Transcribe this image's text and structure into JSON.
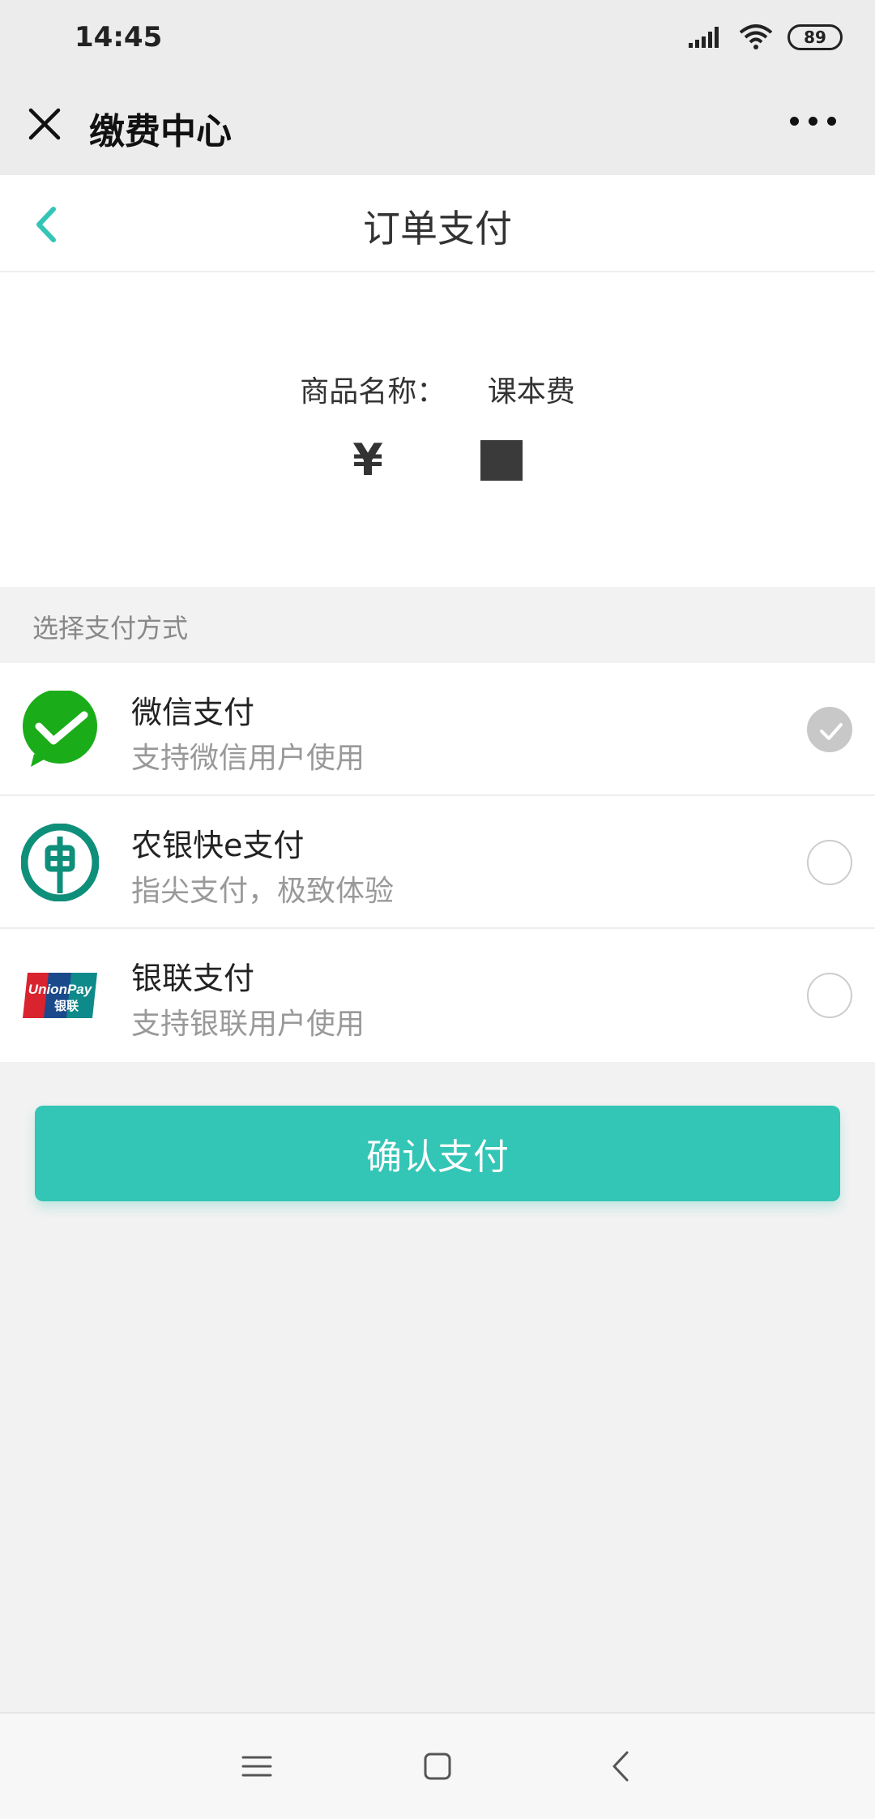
{
  "status_bar": {
    "time": "14:45",
    "battery": "89"
  },
  "wechat_bar": {
    "title": "缴费中心"
  },
  "header": {
    "title": "订单支付"
  },
  "order": {
    "product_label": "商品名称：",
    "product_name": "课本费",
    "currency_symbol": "¥"
  },
  "payment": {
    "section_label": "选择支付方式",
    "methods": [
      {
        "name": "微信支付",
        "desc": "支持微信用户使用",
        "selected": true,
        "icon": "wechat-pay-icon"
      },
      {
        "name": "农银快e支付",
        "desc": "指尖支付，极致体验",
        "selected": false,
        "icon": "abc-bank-icon"
      },
      {
        "name": "银联支付",
        "desc": "支持银联用户使用",
        "selected": false,
        "icon": "unionpay-icon"
      }
    ]
  },
  "unionpay_logo": {
    "line1": "UnionPay",
    "line2": "银联"
  },
  "confirm_button": {
    "label": "确认支付"
  },
  "colors": {
    "accent": "#33c5b5",
    "wechat_green": "#1aad19",
    "abc_green": "#0e8f7a"
  }
}
